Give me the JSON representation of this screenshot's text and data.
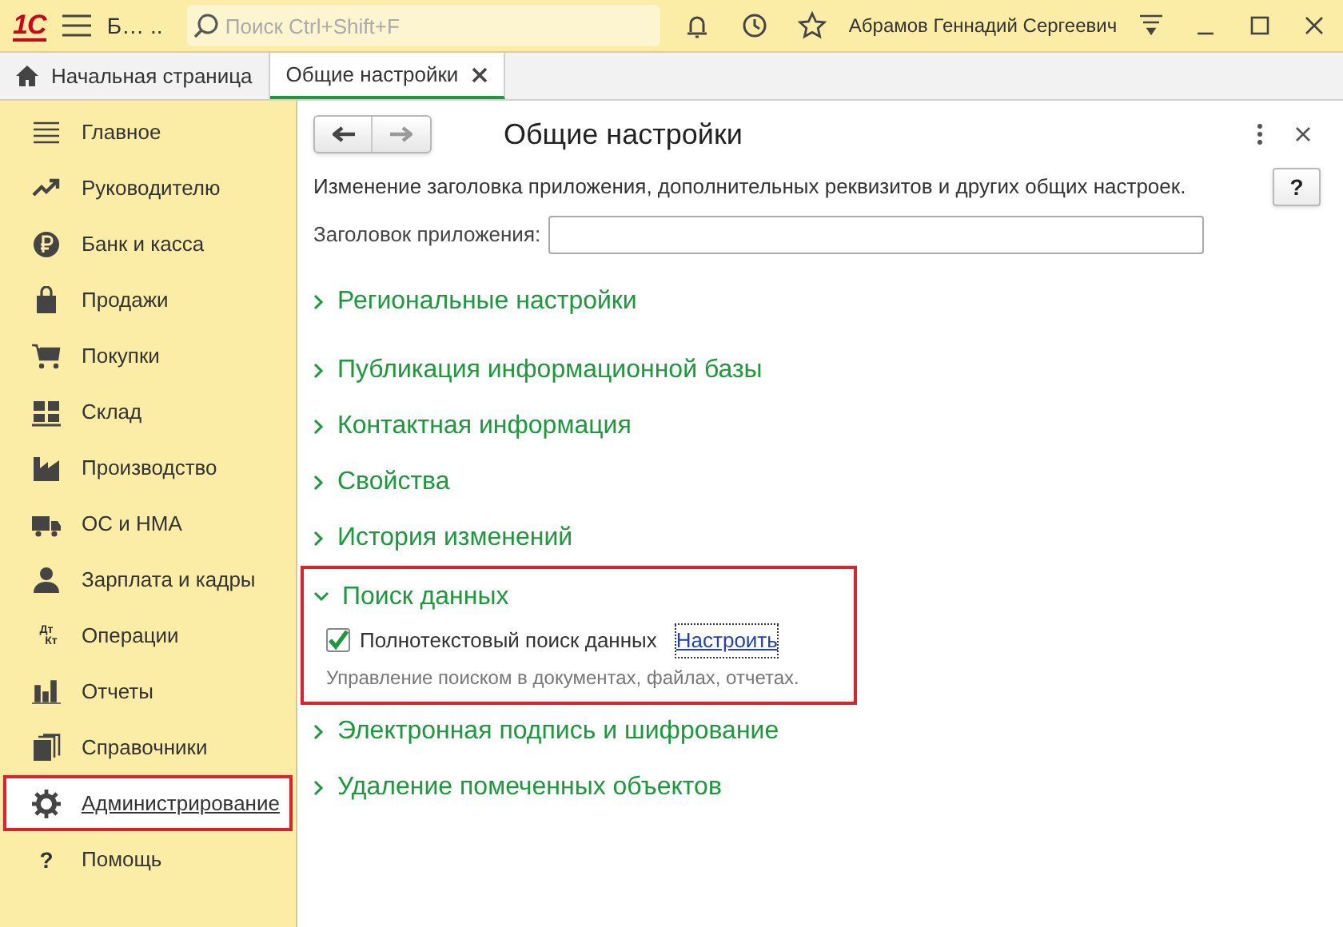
{
  "titlebar": {
    "logo": "1С",
    "app_title": "Б… ..",
    "search": {
      "placeholder": "Поиск Ctrl+Shift+F"
    },
    "user": "Абрамов Геннадий Сергеевич"
  },
  "tabs": [
    {
      "label": "Начальная страница",
      "selected": false,
      "kind": "home"
    },
    {
      "label": "Общие настройки",
      "selected": true,
      "kind": "closable"
    }
  ],
  "sidebar": {
    "items": [
      {
        "label": "Главное",
        "selected": false
      },
      {
        "label": "Руководителю",
        "selected": false
      },
      {
        "label": "Банк и касса",
        "selected": false
      },
      {
        "label": "Продажи",
        "selected": false
      },
      {
        "label": "Покупки",
        "selected": false
      },
      {
        "label": "Склад",
        "selected": false
      },
      {
        "label": "Производство",
        "selected": false
      },
      {
        "label": "ОС и НМА",
        "selected": false
      },
      {
        "label": "Зарплата и кадры",
        "selected": false
      },
      {
        "label": "Операции",
        "selected": false,
        "icon_text": [
          "Дт",
          "Кт"
        ]
      },
      {
        "label": "Отчеты",
        "selected": false
      },
      {
        "label": "Справочники",
        "selected": false
      },
      {
        "label": "Администрирование",
        "selected": true
      },
      {
        "label": "Помощь",
        "selected": false,
        "icon_text": [
          "?"
        ]
      }
    ]
  },
  "form": {
    "title": "Общие настройки",
    "help": "?",
    "description": "Изменение заголовка приложения, дополнительных реквизитов и других общих настроек.",
    "field": {
      "label": "Заголовок приложения:"
    },
    "sections": [
      {
        "title": "Региональные настройки",
        "expanded": false,
        "highlighted": false
      },
      {
        "title": "Публикация информационной базы",
        "expanded": false,
        "highlighted": false
      },
      {
        "title": "Контактная информация",
        "expanded": false,
        "highlighted": false
      },
      {
        "title": "Свойства",
        "expanded": false,
        "highlighted": false
      },
      {
        "title": "История изменений",
        "expanded": false,
        "highlighted": false
      },
      {
        "title": "Поиск данных",
        "expanded": true,
        "highlighted": true,
        "checkbox": {
          "label": "Полнотекстовый поиск данных",
          "checked": true
        },
        "link": "Настроить",
        "note": "Управление поиском в документах, файлах, отчетах."
      },
      {
        "title": "Электронная подпись и шифрование",
        "expanded": false,
        "highlighted": false
      },
      {
        "title": "Удаление помеченных объектов",
        "expanded": false,
        "highlighted": false
      }
    ]
  }
}
